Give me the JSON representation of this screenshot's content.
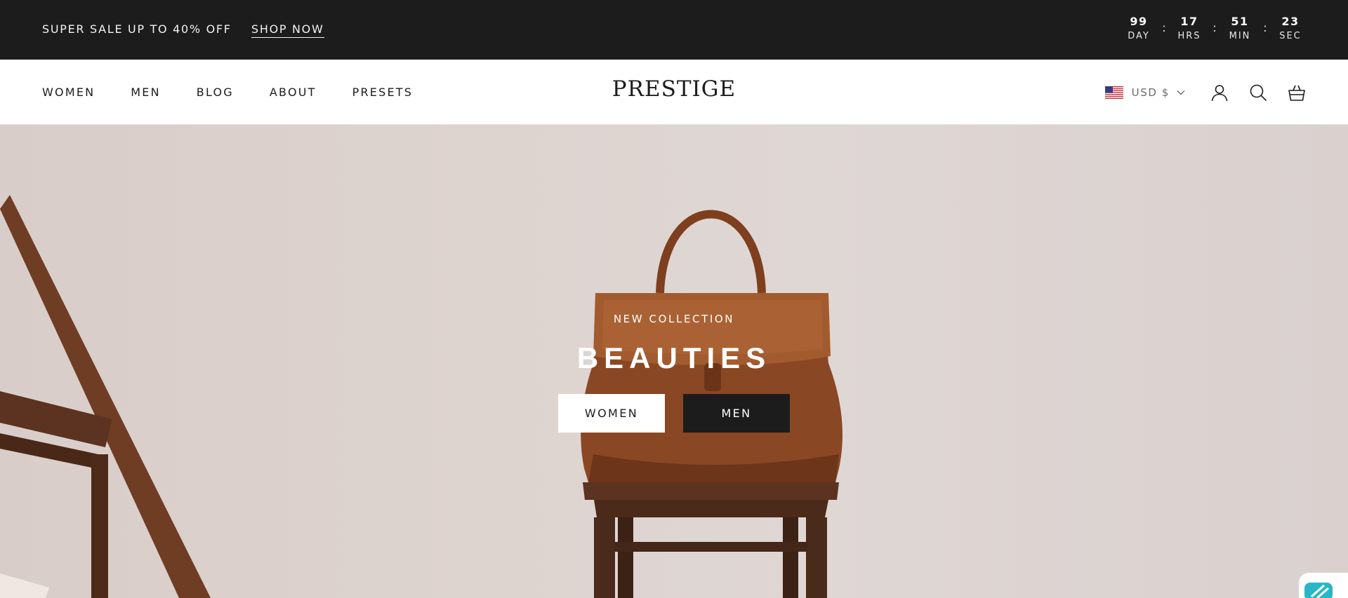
{
  "announcement": {
    "text": "SUPER SALE UP TO 40% OFF",
    "link": "SHOP NOW",
    "countdown": [
      {
        "value": "99",
        "label": "DAY"
      },
      {
        "value": "17",
        "label": "HRS"
      },
      {
        "value": "51",
        "label": "MIN"
      },
      {
        "value": "23",
        "label": "SEC"
      }
    ],
    "separator": ":"
  },
  "header": {
    "nav": [
      "WOMEN",
      "MEN",
      "BLOG",
      "ABOUT",
      "PRESETS"
    ],
    "logo": "PRESTIGE",
    "currency": "USD $",
    "icons": [
      "account-icon",
      "search-icon",
      "cart-icon"
    ]
  },
  "hero": {
    "eyebrow": "NEW COLLECTION",
    "headline": "BEAUTIES",
    "buttons": [
      "WOMEN",
      "MEN"
    ]
  },
  "colors": {
    "bar": "#1c1c1c",
    "text_dark": "#1c1c1c",
    "leather": "#8a4a25",
    "hero_bg": "#ddd3cf"
  }
}
